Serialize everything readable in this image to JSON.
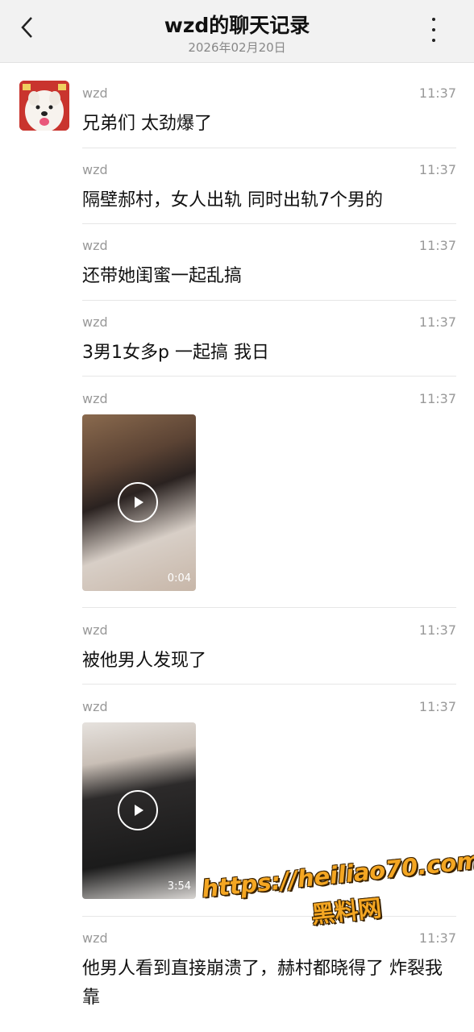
{
  "header": {
    "title": "wzd的聊天记录",
    "subtitle": "2026年02月20日",
    "back_icon": "chevron-left-icon",
    "more_icon": "more-vertical-icon"
  },
  "messages": [
    {
      "name": "wzd",
      "time": "11:37",
      "text": "兄弟们 太劲爆了"
    },
    {
      "name": "wzd",
      "time": "11:37",
      "text": "隔壁郝村，女人出轨 同时出轨7个男的"
    },
    {
      "name": "wzd",
      "time": "11:37",
      "text": "还带她闺蜜一起乱搞"
    },
    {
      "name": "wzd",
      "time": "11:37",
      "text": "3男1女多p 一起搞 我日"
    },
    {
      "name": "wzd",
      "time": "11:37",
      "video_duration": "0:04"
    },
    {
      "name": "wzd",
      "time": "11:37",
      "text": "被他男人发现了"
    },
    {
      "name": "wzd",
      "time": "11:37",
      "video_duration": "3:54"
    },
    {
      "name": "wzd",
      "time": "11:37",
      "text": "他男人看到直接崩溃了，赫村都晓得了 炸裂我靠"
    }
  ],
  "watermark": {
    "url": "https://heiliao70.com",
    "name": "黑料网"
  },
  "colors": {
    "header_bg": "#f2f2f2",
    "meta_text": "#999999",
    "watermark": "#f4a622"
  }
}
